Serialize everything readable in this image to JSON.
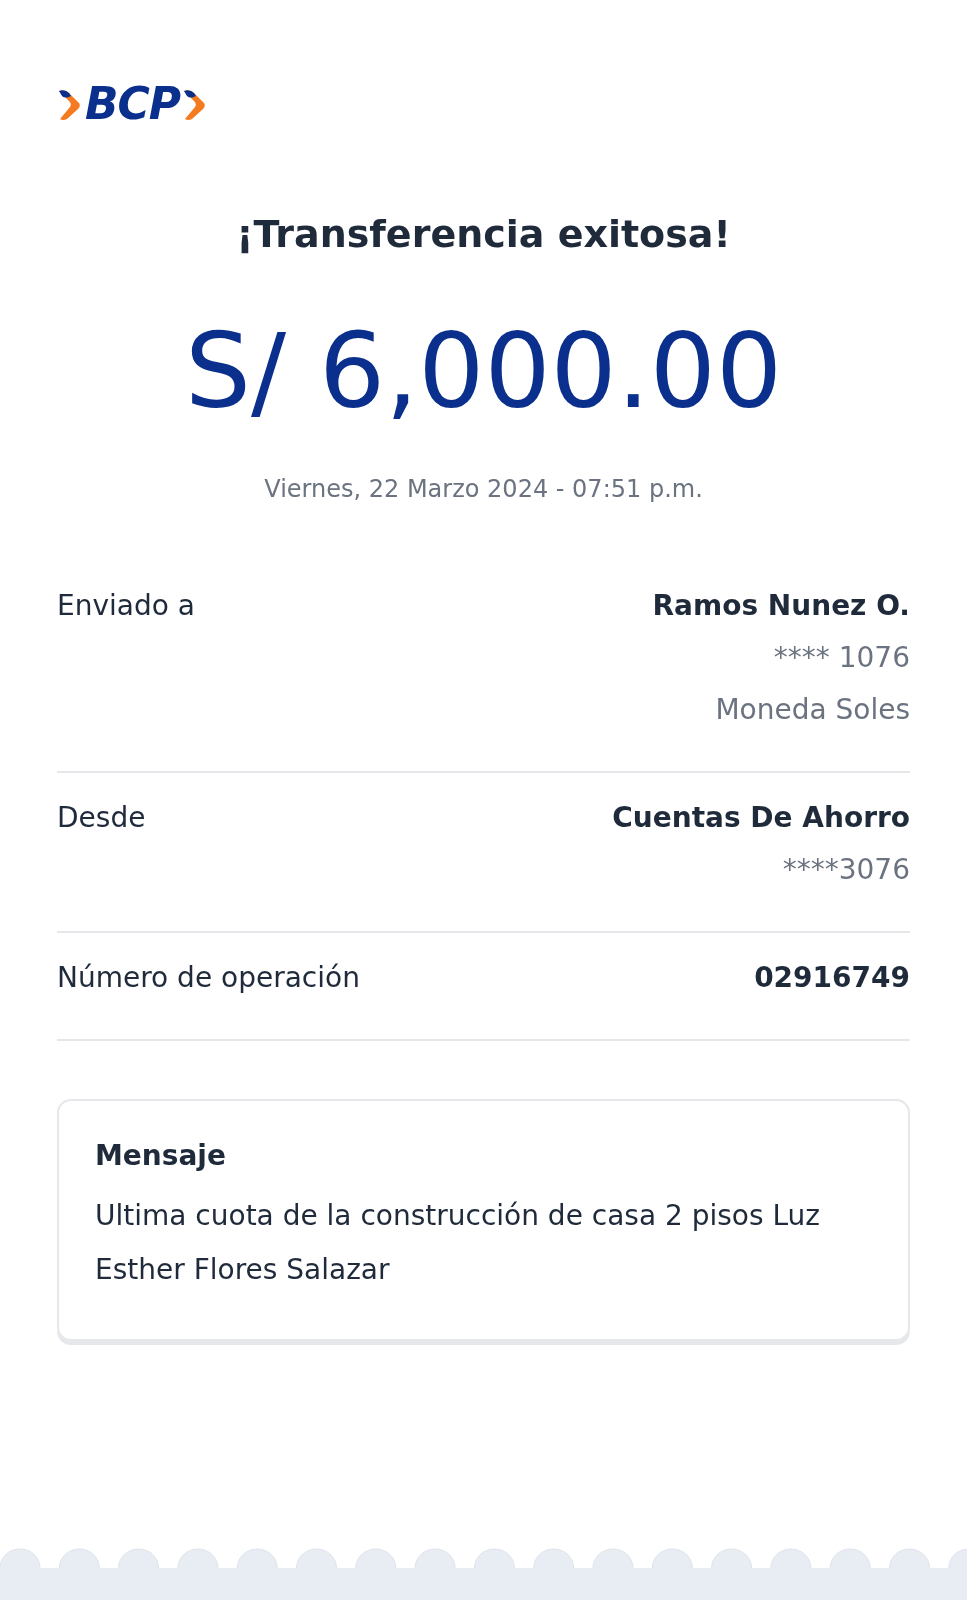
{
  "logo": {
    "text": "BCP"
  },
  "title": "¡Transferencia exitosa!",
  "amount": "S/ 6,000.00",
  "date": "Viernes, 22 Marzo 2024 - 07:51 p.m.",
  "details": [
    {
      "label": "Enviado a",
      "values": [
        "Ramos Nunez O.",
        "**** 1076",
        "Moneda Soles"
      ]
    },
    {
      "label": "Desde",
      "values": [
        "Cuentas De Ahorro",
        "****3076"
      ]
    },
    {
      "label": "Número de operación",
      "values": [
        "02916749"
      ]
    }
  ],
  "message": {
    "title": "Mensaje",
    "text": "Ultima cuota de la construcción de casa 2 pisos Luz Esther Flores Salazar"
  }
}
